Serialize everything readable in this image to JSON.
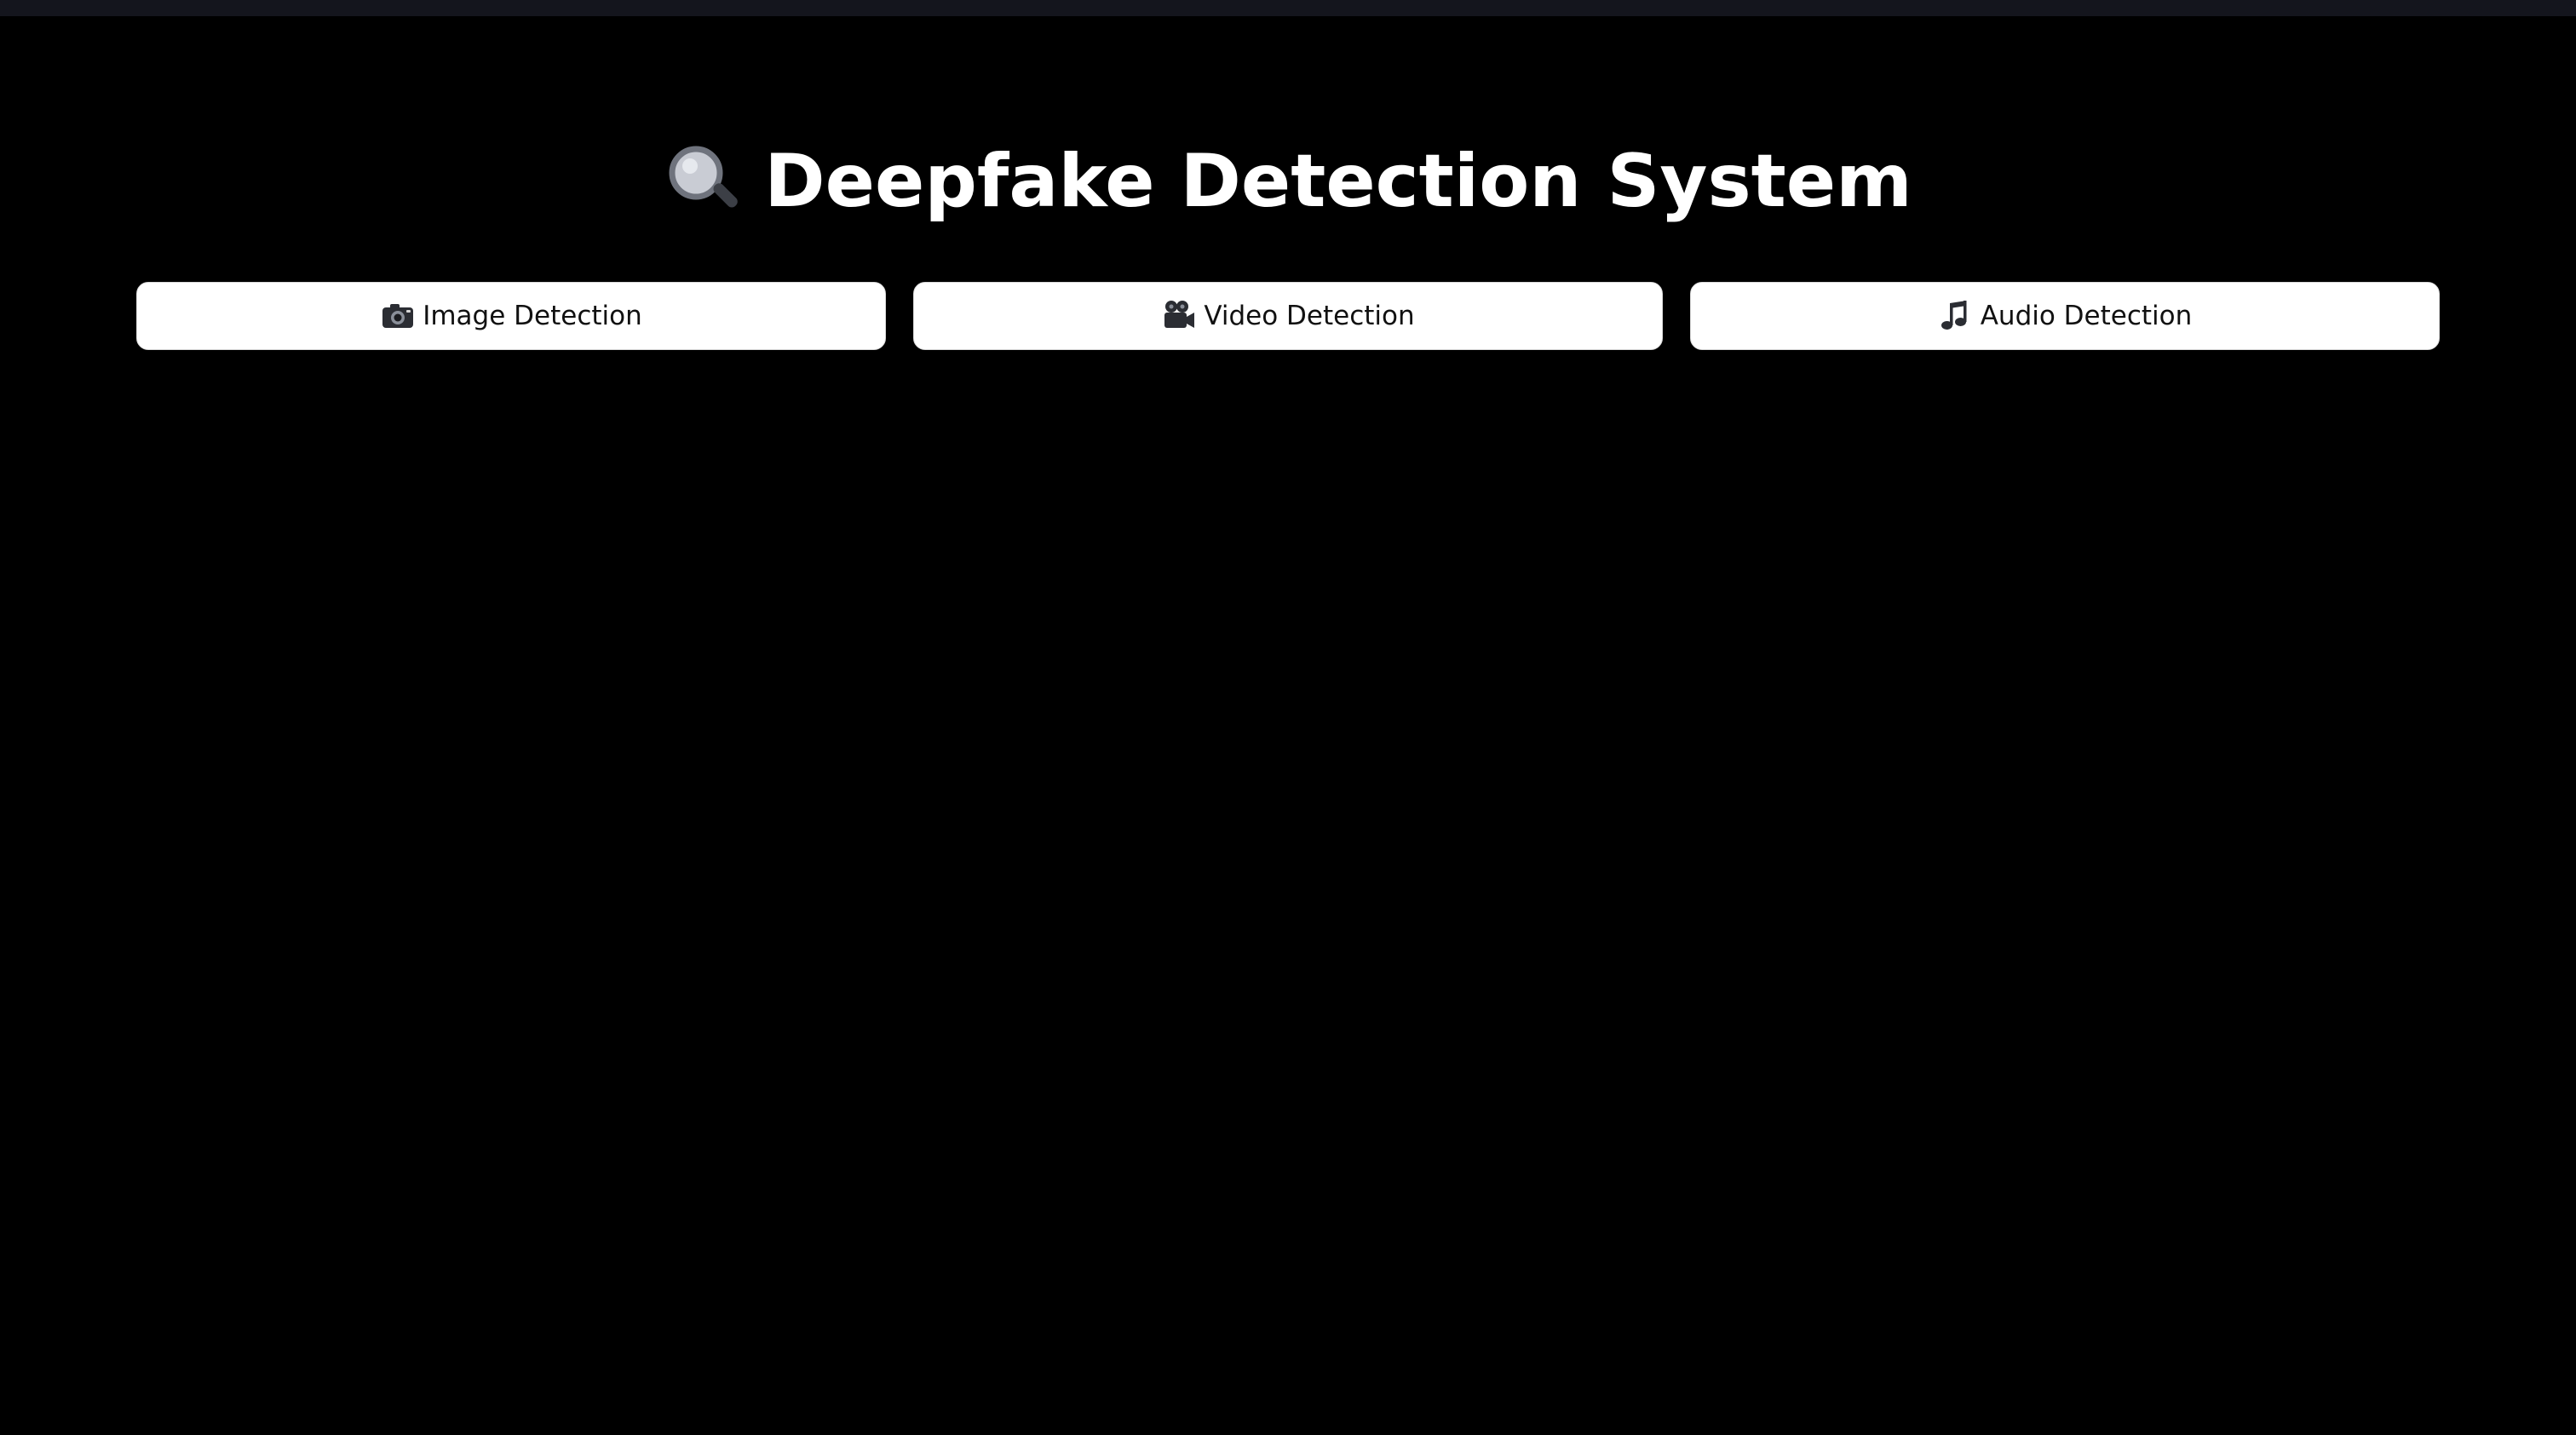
{
  "header": {
    "title": "Deepfake Detection System",
    "title_icon": "magnifying-glass-icon",
    "top_bar_color": "#14151d"
  },
  "tabs": [
    {
      "label": "Image Detection",
      "icon": "camera-icon"
    },
    {
      "label": "Video Detection",
      "icon": "movie-camera-icon"
    },
    {
      "label": "Audio Detection",
      "icon": "music-note-icon"
    }
  ],
  "colors": {
    "background": "#000000",
    "text": "#ffffff",
    "button_background": "#ffffff",
    "button_text": "#111111"
  }
}
